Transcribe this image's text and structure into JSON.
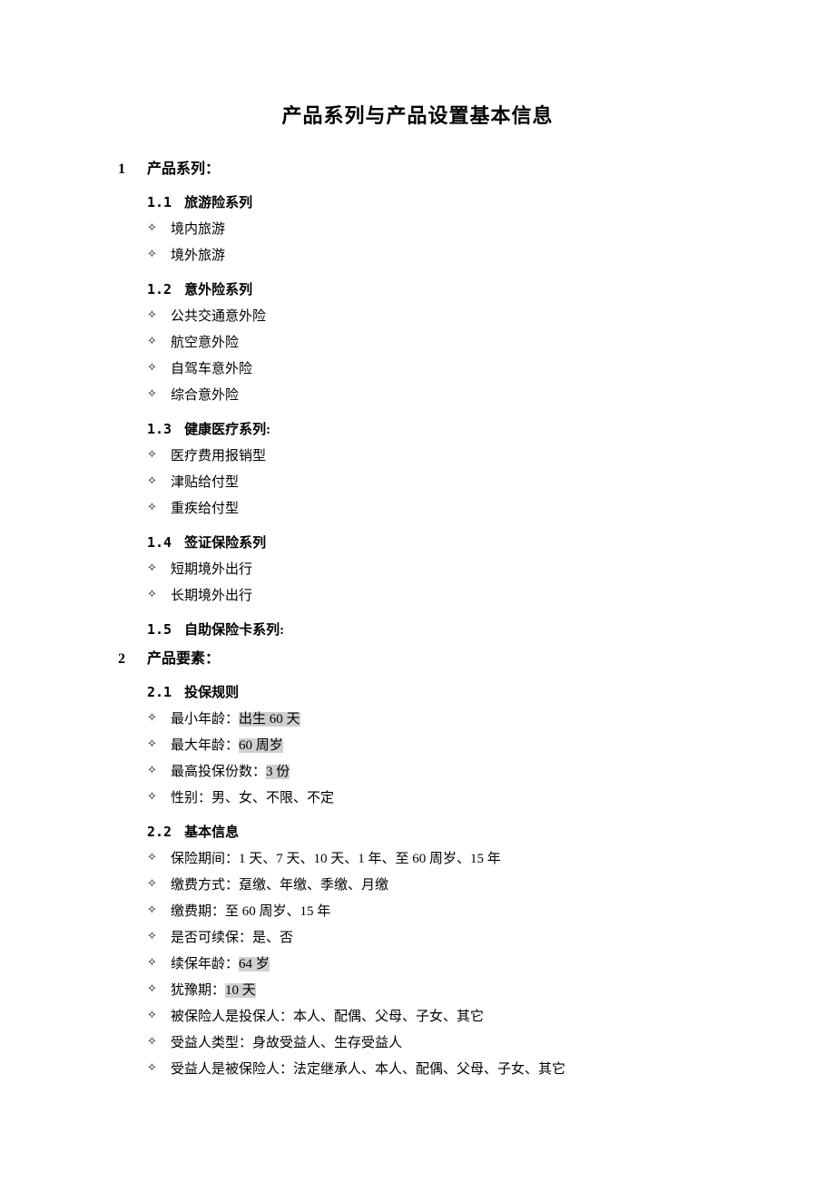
{
  "title": "产品系列与产品设置基本信息",
  "sec1": {
    "num": "1",
    "title": "产品系列：",
    "s1": {
      "num": "1.1",
      "title": "旅游险系列",
      "items": [
        "境内旅游",
        "境外旅游"
      ]
    },
    "s2": {
      "num": "1.2",
      "title": "意外险系列",
      "items": [
        "公共交通意外险",
        "航空意外险",
        "自驾车意外险",
        "综合意外险"
      ]
    },
    "s3": {
      "num": "1.3",
      "title": "健康医疗系列:",
      "items": [
        "医疗费用报销型",
        "津贴给付型",
        "重疾给付型"
      ]
    },
    "s4": {
      "num": "1.4",
      "title": "签证保险系列",
      "items": [
        "短期境外出行",
        "长期境外出行"
      ]
    },
    "s5": {
      "num": "1.5",
      "title": "自助保险卡系列:"
    }
  },
  "sec2": {
    "num": "2",
    "title": "产品要素：",
    "s1": {
      "num": "2.1",
      "title": "投保规则",
      "i1": {
        "label": "最小年龄：",
        "hl": "出生 60 天"
      },
      "i2": {
        "label": "最大年龄：",
        "hl": "60 周岁"
      },
      "i3": {
        "label": "最高投保份数：",
        "hl": "3 份"
      },
      "i4": {
        "text": "性别：男、女、不限、不定"
      }
    },
    "s2": {
      "num": "2.2",
      "title": "基本信息",
      "i1": {
        "text": "保险期间：1 天、7 天、10 天、1 年、至 60 周岁、15 年"
      },
      "i2": {
        "text": "缴费方式：趸缴、年缴、季缴、月缴"
      },
      "i3": {
        "text": "缴费期：至 60 周岁、15 年"
      },
      "i4": {
        "text": "是否可续保：是、否"
      },
      "i5": {
        "label": "续保年龄：",
        "hl": "64 岁"
      },
      "i6": {
        "label": "犹豫期：",
        "hl": "10 天"
      },
      "i7": {
        "text": "被保险人是投保人：本人、配偶、父母、子女、其它"
      },
      "i8": {
        "text": "受益人类型：身故受益人、生存受益人"
      },
      "i9": {
        "text": "受益人是被保险人：法定继承人、本人、配偶、父母、子女、其它"
      }
    }
  },
  "bullet": "✧"
}
